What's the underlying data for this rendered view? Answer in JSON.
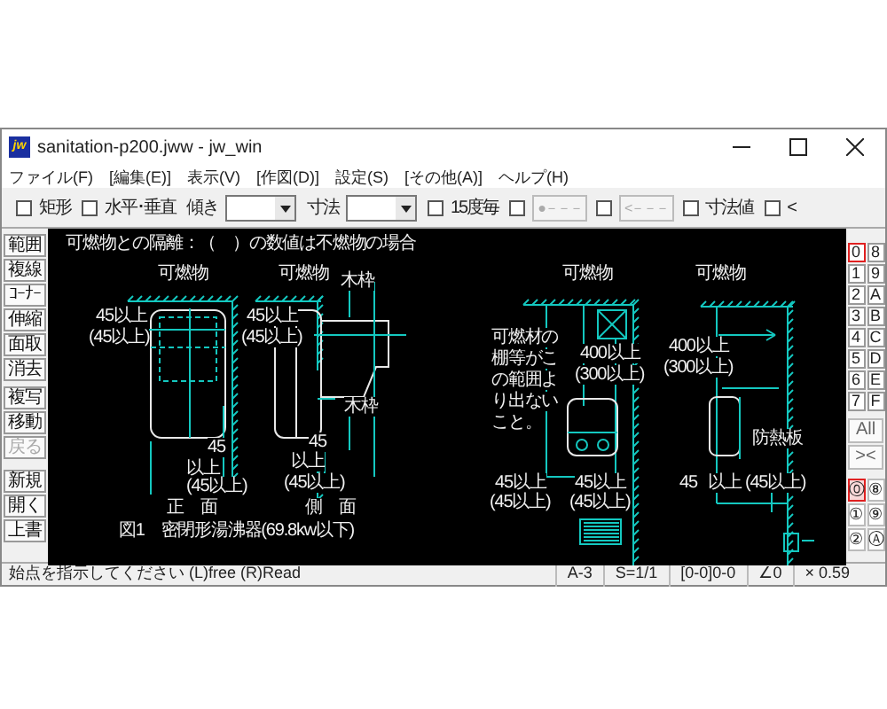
{
  "window": {
    "title": "sanitation-p200.jww - jw_win",
    "icon_text": "jw"
  },
  "menu": [
    {
      "label": "ファイル(F)"
    },
    {
      "label": "[編集(E)]"
    },
    {
      "label": "表示(V)"
    },
    {
      "label": "[作図(D)]"
    },
    {
      "label": "設定(S)"
    },
    {
      "label": "[その他(A)]"
    },
    {
      "label": "ヘルプ(H)"
    }
  ],
  "toolbar": [
    {
      "kind": "checkbox",
      "label": "矩形",
      "checked": false
    },
    {
      "kind": "checkbox",
      "label": "水平･垂直",
      "checked": false
    },
    {
      "kind": "combo",
      "label": "傾き"
    },
    {
      "kind": "combo",
      "label": "寸法"
    },
    {
      "kind": "checkbox",
      "label": "15度毎",
      "checked": false
    },
    {
      "kind": "checkbox",
      "checked": false
    },
    {
      "kind": "button",
      "label": "●－－－",
      "disabled": true
    },
    {
      "kind": "checkbox",
      "checked": false
    },
    {
      "kind": "button",
      "label": "<－－－",
      "disabled": true
    },
    {
      "kind": "checkbox",
      "label": "寸法値",
      "checked": false
    },
    {
      "kind": "checkbox",
      "label": "<",
      "checked": false
    }
  ],
  "left_tools": [
    {
      "label": "範囲",
      "disabled": false
    },
    {
      "label": "複線",
      "disabled": false
    },
    {
      "label": "ｺｰﾅｰ",
      "disabled": false
    },
    {
      "label": "伸縮",
      "disabled": false
    },
    {
      "label": "面取",
      "disabled": false
    },
    {
      "label": "消去",
      "disabled": false
    },
    {
      "label": "複写",
      "disabled": false
    },
    {
      "label": "移動",
      "disabled": false
    },
    {
      "label": "戻る",
      "disabled": true
    },
    {
      "label": "新規",
      "disabled": false
    },
    {
      "label": "開く",
      "disabled": false
    },
    {
      "label": "上書",
      "disabled": false
    }
  ],
  "drawing": {
    "texts": [
      "可燃物との隔離：（　）の数値は不燃物の場合",
      "可燃物",
      "可燃物",
      "木枠",
      "45以上",
      "(45以上)",
      "45以上",
      "(45以上)",
      "木枠",
      "45",
      "以上",
      "(45以上)",
      "45",
      "以上",
      "(45以上)",
      "正　面",
      "側　面",
      "図1　密閉形湯沸器(69.8kw以下)",
      "可燃物",
      "可燃物",
      "可燃材の",
      "棚等がこ",
      "の範囲よ",
      "り出ない",
      "こと。",
      "400以上",
      "(300以上)",
      "400以上",
      "(300以上)",
      "防熱板",
      "45以上",
      "(45以上)",
      "45以上",
      "(45以上)",
      "45",
      "以上 (45以上)"
    ]
  },
  "layers": [
    {
      "label": "0",
      "selected": true
    },
    {
      "label": "8",
      "selected": false
    },
    {
      "label": "1",
      "selected": false
    },
    {
      "label": "9",
      "selected": false
    },
    {
      "label": "2",
      "selected": false
    },
    {
      "label": "A",
      "selected": false
    },
    {
      "label": "3",
      "selected": false
    },
    {
      "label": "B",
      "selected": false
    },
    {
      "label": "4",
      "selected": false
    },
    {
      "label": "C",
      "selected": false
    },
    {
      "label": "5",
      "selected": false
    },
    {
      "label": "D",
      "selected": false
    },
    {
      "label": "6",
      "selected": false
    },
    {
      "label": "E",
      "selected": false
    },
    {
      "label": "7",
      "selected": false
    },
    {
      "label": "F",
      "selected": false
    }
  ],
  "layer_buttons": [
    "All",
    "><"
  ],
  "layer_groups": [
    {
      "label": "⓪",
      "selected": true
    },
    {
      "label": "⑧",
      "selected": false
    },
    {
      "label": "①",
      "selected": false
    },
    {
      "label": "⑨",
      "selected": false
    },
    {
      "label": "②",
      "selected": false
    },
    {
      "label": "Ⓐ",
      "selected": false
    }
  ],
  "status": {
    "message": "始点を指示してください (L)free (R)Read",
    "fields": [
      "A-3",
      "S=1/1",
      "[0-0]0-0",
      "∠0",
      "× 0.59"
    ]
  }
}
